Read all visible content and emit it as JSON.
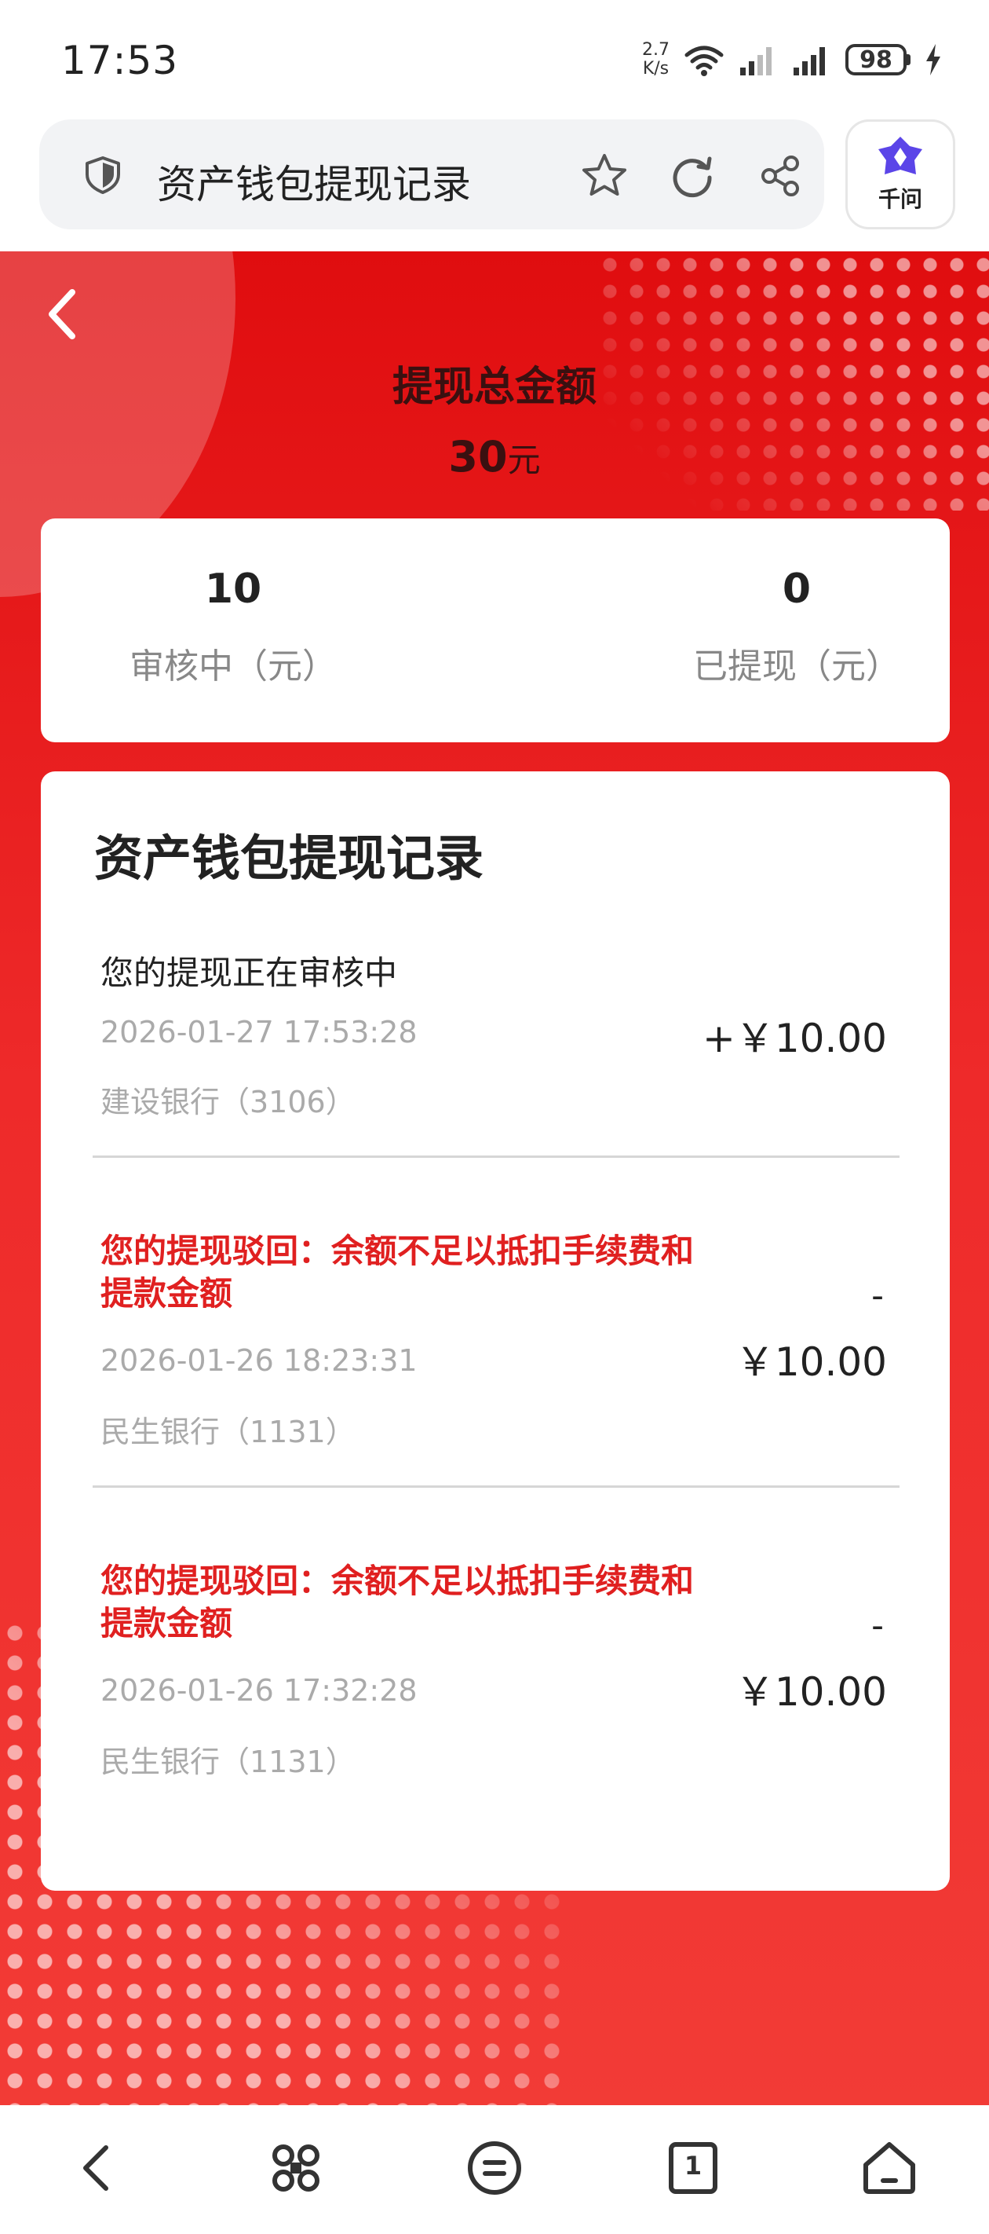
{
  "status_bar": {
    "time": "17:53",
    "net_speed_value": "2.7",
    "net_speed_unit": "K/s",
    "battery": "98"
  },
  "browser": {
    "address_title": "资产钱包提现记录",
    "assistant_label": "千问"
  },
  "header": {
    "title": "提现总金额",
    "total_value": "30",
    "total_unit": "元"
  },
  "summary": {
    "reviewing_value": "10",
    "reviewing_label": "审核中（元）",
    "withdrawn_value": "0",
    "withdrawn_label": "已提现（元）"
  },
  "records": {
    "title": "资产钱包提现记录",
    "items": [
      {
        "status": "您的提现正在审核中",
        "time": "2026-01-27 17:53:28",
        "bank": "建设银行（3106）",
        "amount": "+￥10.00",
        "sign": ""
      },
      {
        "status": "您的提现驳回：余额不足以抵扣手续费和提款金额",
        "time": "2026-01-26 18:23:31",
        "bank": "民生银行（1131）",
        "amount": "￥10.00",
        "sign": "-"
      },
      {
        "status": "您的提现驳回：余额不足以抵扣手续费和提款金额",
        "time": "2026-01-26 17:32:28",
        "bank": "民生银行（1131）",
        "amount": "￥10.00",
        "sign": "-"
      }
    ]
  },
  "bottom_nav": {
    "tab_count": "1"
  },
  "colors": {
    "brand_red": "#e00d0f",
    "rejected_text": "#e02020"
  }
}
